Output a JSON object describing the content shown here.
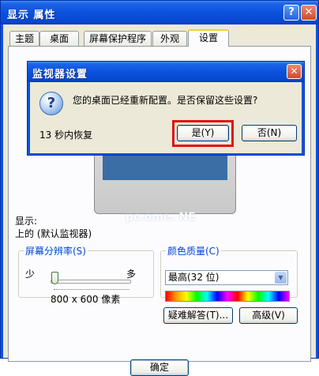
{
  "window": {
    "title": "显示 属性",
    "help_glyph": "?",
    "close_glyph": "✕"
  },
  "tabs": [
    "主题",
    "桌面",
    "屏幕保护程序",
    "外观",
    "设置"
  ],
  "active_tab_index": 4,
  "watermark": "pc.ome. NE",
  "display": {
    "label": "显示:",
    "value": "上的 (默认监视器)"
  },
  "resolution": {
    "legend": "屏幕分辨率(S)",
    "less": "少",
    "more": "多",
    "value": "800 x 600 像素",
    "slider_fraction": 0.0
  },
  "color_quality": {
    "legend": "颜色质量(C)",
    "selected": "最高(32 位)",
    "arrow_glyph": "▼"
  },
  "buttons": {
    "troubleshoot": "疑难解答(T)...",
    "advanced": "高级(V)",
    "ok": "确定"
  },
  "dialog": {
    "title": "监视器设置",
    "close_glyph": "✕",
    "icon_glyph": "?",
    "message": "您的桌面已经重新配置。是否保留这些设置?",
    "countdown": "13 秒内恢复",
    "yes": "是(Y)",
    "no": "否(N)"
  },
  "highlight_color": "#e01010",
  "accent_color": "#0a54e2"
}
